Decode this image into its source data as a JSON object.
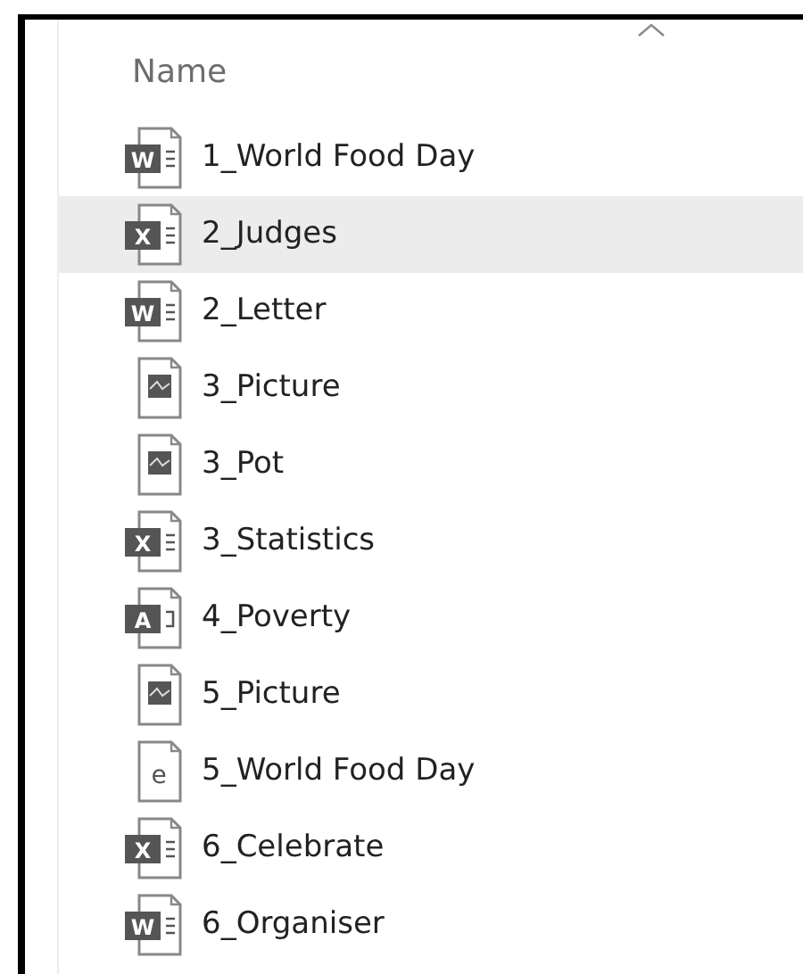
{
  "column_header": "Name",
  "files": [
    {
      "name": "1_World Food Day",
      "kind": "word",
      "icon_letter": "W",
      "selected": false
    },
    {
      "name": "2_Judges",
      "kind": "excel",
      "icon_letter": "X",
      "selected": true
    },
    {
      "name": "2_Letter",
      "kind": "word",
      "icon_letter": "W",
      "selected": false
    },
    {
      "name": "3_Picture",
      "kind": "image",
      "selected": false
    },
    {
      "name": "3_Pot",
      "kind": "image",
      "selected": false
    },
    {
      "name": "3_Statistics",
      "kind": "excel",
      "icon_letter": "X",
      "selected": false
    },
    {
      "name": "4_Poverty",
      "kind": "access",
      "icon_letter": "A",
      "selected": false
    },
    {
      "name": "5_Picture",
      "kind": "image",
      "selected": false
    },
    {
      "name": "5_World Food Day",
      "kind": "web",
      "icon_letter": "e",
      "selected": false
    },
    {
      "name": "6_Celebrate",
      "kind": "excel",
      "icon_letter": "X",
      "selected": false
    },
    {
      "name": "6_Organiser",
      "kind": "word",
      "icon_letter": "W",
      "selected": false
    }
  ]
}
